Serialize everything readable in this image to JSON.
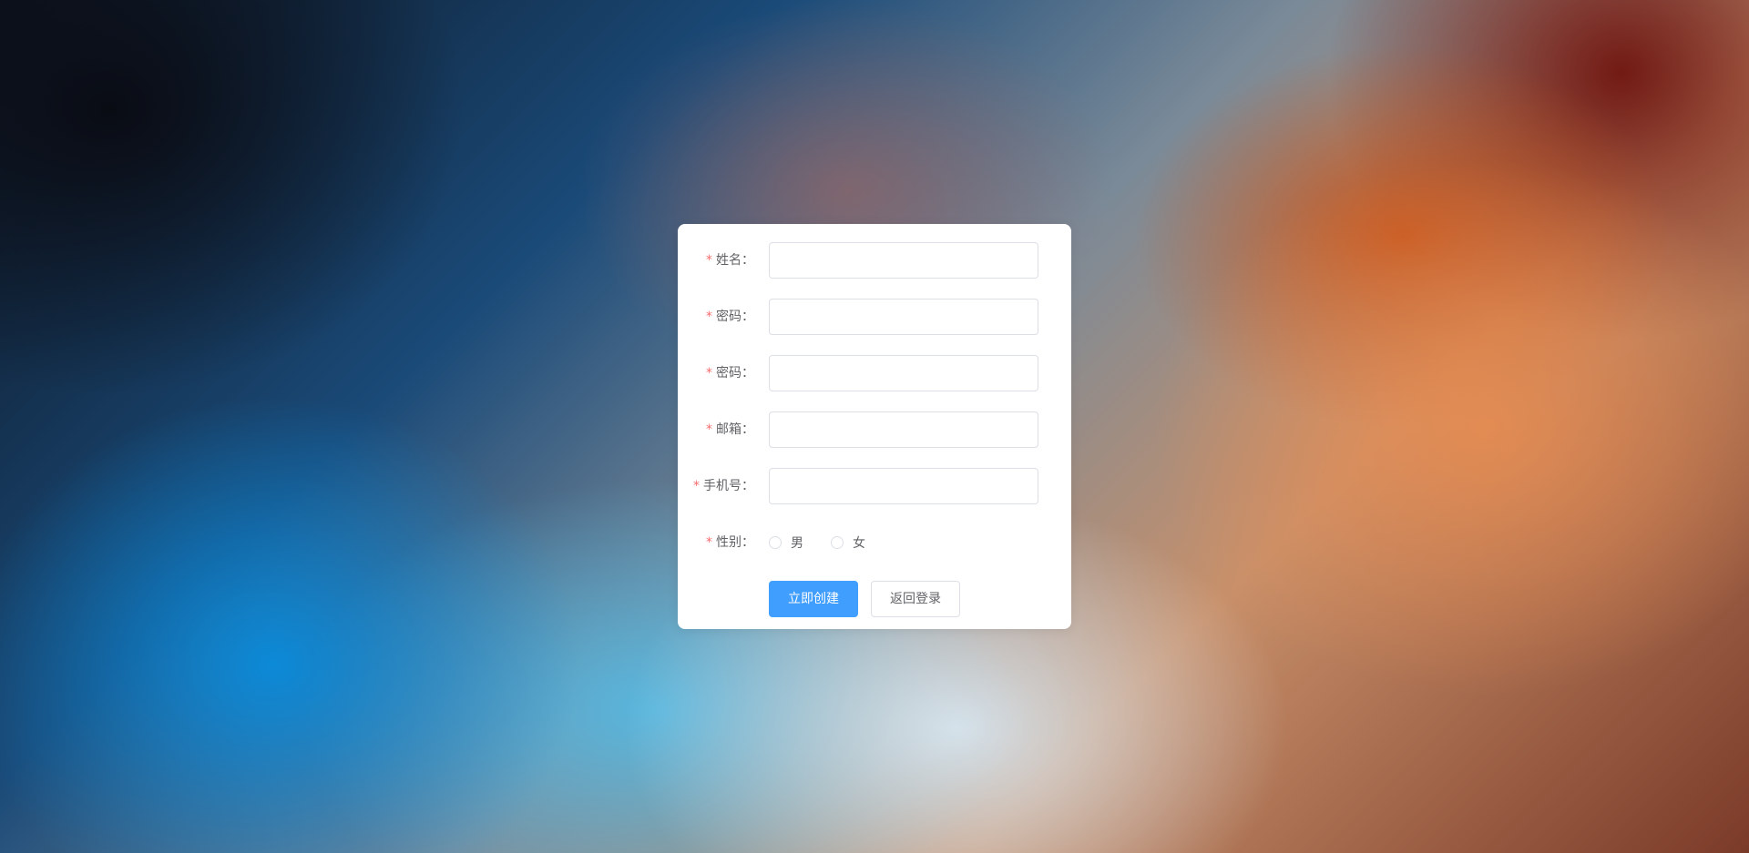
{
  "form": {
    "fields": [
      {
        "label": "姓名：",
        "required_mark": "*",
        "value": "",
        "placeholder": ""
      },
      {
        "label": "密码：",
        "required_mark": "*",
        "value": "",
        "placeholder": ""
      },
      {
        "label": "密码：",
        "required_mark": "*",
        "value": "",
        "placeholder": ""
      },
      {
        "label": "邮箱：",
        "required_mark": "*",
        "value": "",
        "placeholder": ""
      },
      {
        "label": "手机号：",
        "required_mark": "*",
        "value": "",
        "placeholder": ""
      }
    ],
    "gender": {
      "label": "性别：",
      "required_mark": "*",
      "options": [
        "男",
        "女"
      ],
      "selected": null
    },
    "buttons": {
      "create_label": "立即创建",
      "back_label": "返回登录"
    }
  },
  "colors": {
    "primary": "#409eff",
    "required": "#f56c6c",
    "text": "#606266",
    "border": "#dcdfe6",
    "card": "#ffffff"
  }
}
